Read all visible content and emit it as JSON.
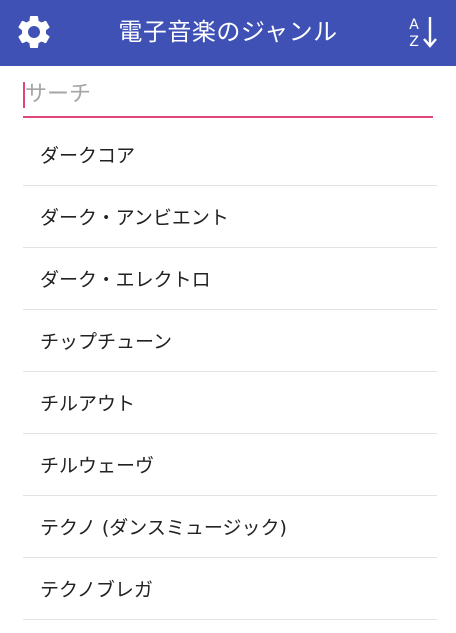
{
  "app_bar": {
    "title": "電子音楽のジャンル",
    "settings_icon": "gear-icon",
    "sort_icon": "sort-alpha-icon",
    "background_color": "#3f51b5"
  },
  "search": {
    "value": "",
    "placeholder": "サーチ",
    "accent_color": "#e0457b"
  },
  "genres": [
    "ダークコア",
    "ダーク・アンビエント",
    "ダーク・エレクトロ",
    "チップチューン",
    "チルアウト",
    "チルウェーヴ",
    "テクノ (ダンスミュージック)",
    "テクノブレガ"
  ]
}
